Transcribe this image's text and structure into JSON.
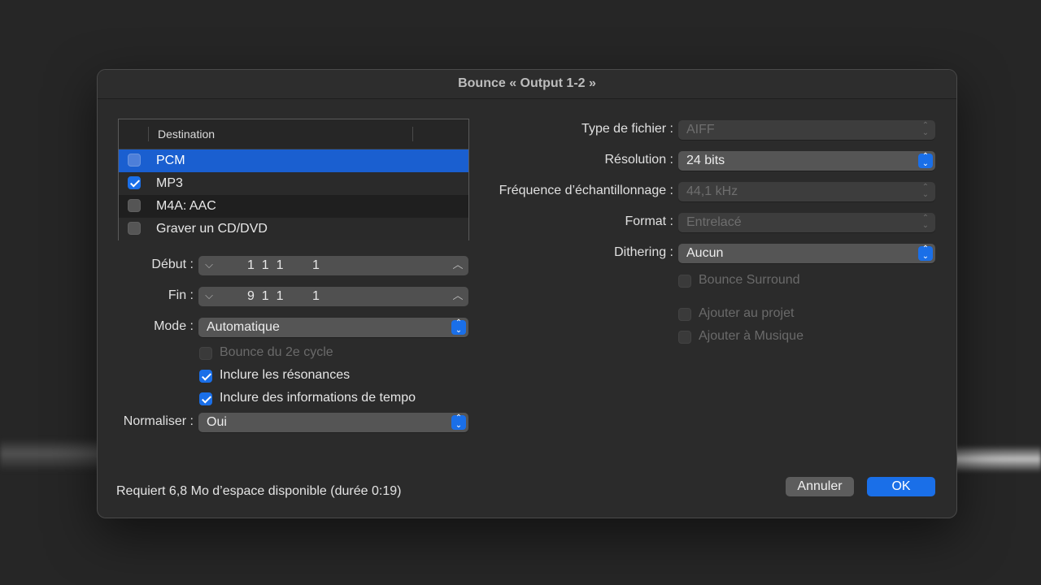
{
  "dialog": {
    "title": "Bounce « Output 1-2 »"
  },
  "destination": {
    "header": "Destination",
    "rows": [
      {
        "label": "PCM",
        "checked": false,
        "selected": true
      },
      {
        "label": "MP3",
        "checked": true,
        "selected": false
      },
      {
        "label": "M4A: AAC",
        "checked": false,
        "selected": false
      },
      {
        "label": "Graver un CD/DVD",
        "checked": false,
        "selected": false
      }
    ]
  },
  "left": {
    "debut_label": "Début :",
    "debut_value": "1  1  1        1",
    "fin_label": "Fin :",
    "fin_value": "9  1  1        1",
    "mode_label": "Mode :",
    "mode_value": "Automatique",
    "bounce_cycle": "Bounce du 2e cycle",
    "inclure_resonances": "Inclure les résonances",
    "inclure_tempo": "Inclure des informations de tempo",
    "normaliser_label": "Normaliser :",
    "normaliser_value": "Oui"
  },
  "right": {
    "type_label": "Type de fichier :",
    "type_value": "AIFF",
    "resolution_label": "Résolution :",
    "resolution_value": "24 bits",
    "frequence_label": "Fréquence d’échantillonnage :",
    "frequence_value": "44,1 kHz",
    "format_label": "Format :",
    "format_value": "Entrelacé",
    "dithering_label": "Dithering :",
    "dithering_value": "Aucun",
    "bounce_surround": "Bounce Surround",
    "ajouter_projet": "Ajouter au projet",
    "ajouter_musique": "Ajouter à Musique"
  },
  "footer": {
    "status": "Requiert 6,8 Mo d’espace disponible (durée 0:19)",
    "cancel": "Annuler",
    "ok": "OK"
  },
  "colors": {
    "accent": "#1a6fe8",
    "selection": "#1a5fd0",
    "dialog_bg": "#2b2b2b"
  },
  "icons": {
    "checkbox_checked": "checkmark-icon",
    "stepper_down": "chevron-down-icon",
    "stepper_up": "chevron-up-icon",
    "popup_arrows": "updown-arrows-icon"
  }
}
